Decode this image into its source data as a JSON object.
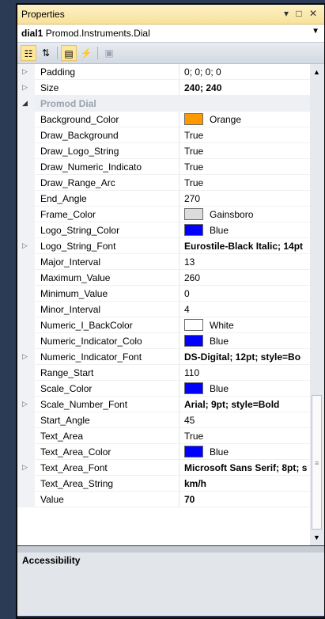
{
  "window": {
    "title": "Properties",
    "buttons": "▾ □ ✕"
  },
  "selector": {
    "object": "dial1",
    "type": "Promod.Instruments.Dial"
  },
  "toolbar": [
    "categorized",
    "alphabetical",
    "properties",
    "events",
    "property-pages"
  ],
  "rows": [
    {
      "name": "Padding",
      "value": "0; 0; 0; 0",
      "expand": true
    },
    {
      "name": "Size",
      "value": "240; 240",
      "expand": true,
      "bold": true
    },
    {
      "name": "Promod Dial",
      "category": true
    },
    {
      "name": "Background_Color",
      "value": "Orange",
      "swatch": "#ff9900"
    },
    {
      "name": "Draw_Background",
      "value": "True"
    },
    {
      "name": "Draw_Logo_String",
      "value": "True"
    },
    {
      "name": "Draw_Numeric_Indicato",
      "value": "True"
    },
    {
      "name": "Draw_Range_Arc",
      "value": "True"
    },
    {
      "name": "End_Angle",
      "value": "270"
    },
    {
      "name": "Frame_Color",
      "value": "Gainsboro",
      "swatch": "#dcdcdc"
    },
    {
      "name": "Logo_String_Color",
      "value": "Blue",
      "swatch": "#0000ff"
    },
    {
      "name": "Logo_String_Font",
      "value": "Eurostile-Black Italic; 14pt",
      "expand": true,
      "bold": true
    },
    {
      "name": "Major_Interval",
      "value": "13"
    },
    {
      "name": "Maximum_Value",
      "value": "260"
    },
    {
      "name": "Minimum_Value",
      "value": "0"
    },
    {
      "name": "Minor_Interval",
      "value": "4"
    },
    {
      "name": "Numeric_I_BackColor",
      "value": "White",
      "swatch": "#ffffff"
    },
    {
      "name": "Numeric_Indicator_Colo",
      "value": "Blue",
      "swatch": "#0000ff"
    },
    {
      "name": "Numeric_Indicator_Font",
      "value": "DS-Digital; 12pt; style=Bo",
      "expand": true,
      "bold": true
    },
    {
      "name": "Range_Start",
      "value": "110"
    },
    {
      "name": "Scale_Color",
      "value": "Blue",
      "swatch": "#0000ff"
    },
    {
      "name": "Scale_Number_Font",
      "value": "Arial; 9pt; style=Bold",
      "expand": true,
      "bold": true
    },
    {
      "name": "Start_Angle",
      "value": "45"
    },
    {
      "name": "Text_Area",
      "value": "True"
    },
    {
      "name": "Text_Area_Color",
      "value": "Blue",
      "swatch": "#0000ff"
    },
    {
      "name": "Text_Area_Font",
      "value": "Microsoft Sans Serif; 8pt; s",
      "expand": true,
      "bold": true
    },
    {
      "name": "Text_Area_String",
      "value": "km/h",
      "bold": true
    },
    {
      "name": "Value",
      "value": "70",
      "bold": true
    }
  ],
  "description": {
    "title": "Accessibility"
  }
}
